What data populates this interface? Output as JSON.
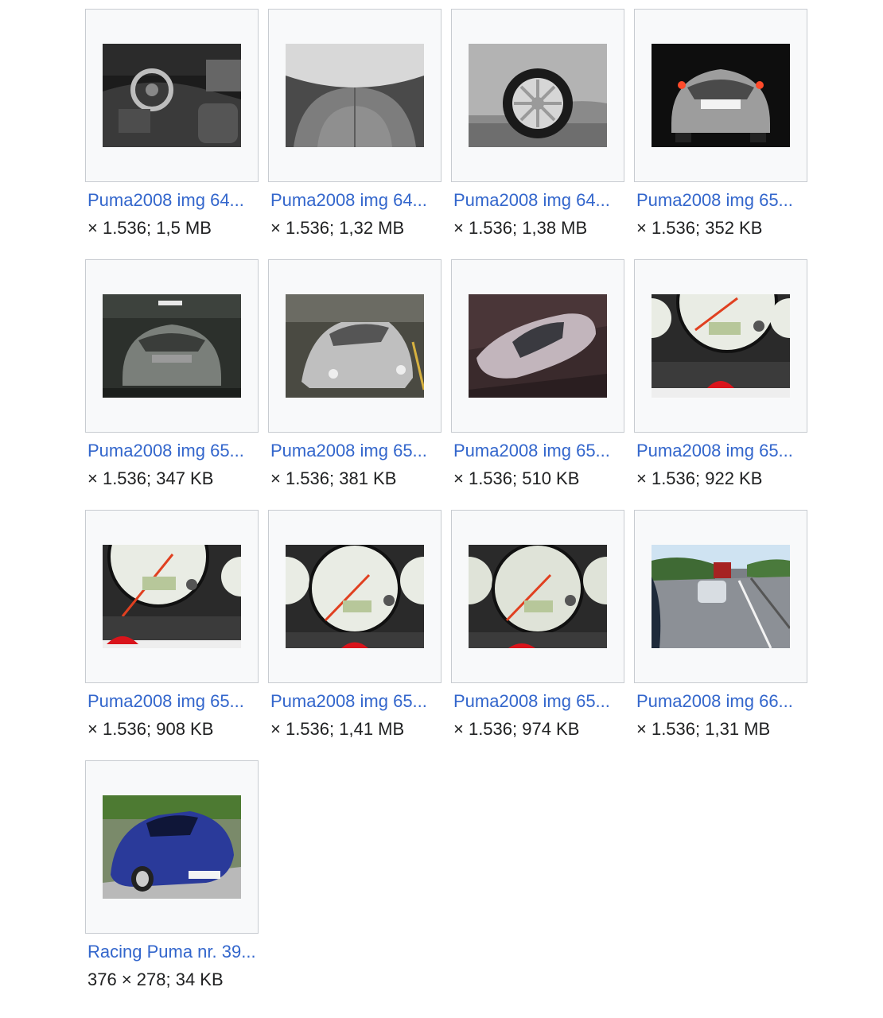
{
  "gallery": {
    "items": [
      {
        "caption": "Puma2008 img 64...",
        "meta": "× 1.536; 1,5 MB",
        "icon": "car-interior-dashboard-photo"
      },
      {
        "caption": "Puma2008 img 64...",
        "meta": "× 1.536; 1,32 MB",
        "icon": "car-rear-seats-photo"
      },
      {
        "caption": "Puma2008 img 64...",
        "meta": "× 1.536; 1,38 MB",
        "icon": "car-wheel-photo"
      },
      {
        "caption": "Puma2008 img 65...",
        "meta": "× 1.536; 352 KB",
        "icon": "car-rear-lights-photo"
      },
      {
        "caption": "Puma2008 img 65...",
        "meta": "× 1.536; 347 KB",
        "icon": "car-rear-garage-photo"
      },
      {
        "caption": "Puma2008 img 65...",
        "meta": "× 1.536; 381 KB",
        "icon": "car-front-garage-photo"
      },
      {
        "caption": "Puma2008 img 65...",
        "meta": "× 1.536; 510 KB",
        "icon": "car-top-view-photo"
      },
      {
        "caption": "Puma2008 img 65...",
        "meta": "× 1.536; 922 KB",
        "icon": "odometer-photo"
      },
      {
        "caption": "Puma2008 img 65...",
        "meta": "× 1.536; 908 KB",
        "icon": "odometer-photo"
      },
      {
        "caption": "Puma2008 img 65...",
        "meta": "× 1.536; 1,41 MB",
        "icon": "speedometer-photo"
      },
      {
        "caption": "Puma2008 img 65...",
        "meta": "× 1.536; 974 KB",
        "icon": "speedometer-photo"
      },
      {
        "caption": "Puma2008 img 66...",
        "meta": "× 1.536; 1,31 MB",
        "icon": "highway-traffic-photo"
      },
      {
        "caption": "Racing Puma nr. 39...",
        "meta": "376 × 278; 34 KB",
        "icon": "blue-car-photo"
      }
    ]
  },
  "colors": {
    "link": "#3366cc",
    "text": "#202122",
    "thumb_bg": "#f8f9fa",
    "thumb_border": "#c8ccd1"
  }
}
